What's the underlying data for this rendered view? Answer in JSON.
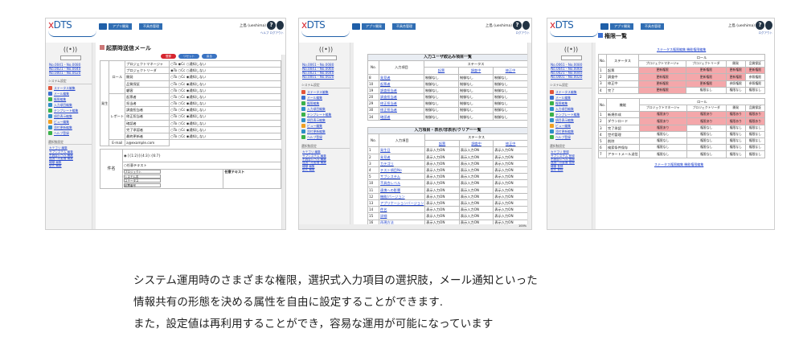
{
  "shot1": {
    "breadcrumb": [
      "アプリ開発",
      "不具合管理"
    ],
    "user": "上島 (ueshima)",
    "help_links": "ヘルプ ログアウト",
    "side": {
      "links": [
        "No.0041 - No.0080",
        "No.0021 - No.0040",
        "No.0001 - No.0020"
      ],
      "section1": "システム設定",
      "menu": [
        {
          "label": "ステータス編集",
          "color": "#e2553a"
        },
        {
          "label": "メール編集",
          "color": "#3b6fd1"
        },
        {
          "label": "権限編集",
          "color": "#3bb24a"
        },
        {
          "label": "入力項目編集",
          "color": "#2e8fc7"
        },
        {
          "label": "テンプレート編集",
          "color": "#3bb24a"
        },
        {
          "label": "項目表示編集",
          "color": "#2e8fc7"
        },
        {
          "label": "ビュー編集",
          "color": "#f0a022"
        },
        {
          "label": "添付更新編集",
          "color": "#2e8fc7"
        },
        {
          "label": "ヘルプ登録",
          "color": "#3bb24a"
        }
      ],
      "section2": "選択肢設定",
      "small": [
        "カテゴリ 編集",
        "サブシステム 編集",
        "不具合レベル 編集",
        "連携への影響 編集",
        "種類 編集",
        "優先 編集"
      ]
    },
    "title": "起票時送信メール",
    "buttons": [
      "登録",
      "リセット",
      "戻る"
    ],
    "group_recv": "発生",
    "group_role": "ロール",
    "group_report": "レポート",
    "email_label": "E-mail",
    "email_value": "a@example.com",
    "rows": [
      [
        "プロジェクトマネージャ",
        "○To ◉Cc ○通知しない"
      ],
      [
        "プロジェクトリーダ",
        "◉To ○Cc ○通知しない"
      ],
      [
        "開発",
        "○To ○Cc ◉通知しない"
      ],
      [
        "品質保証",
        "○To ○Cc ◉通知しない"
      ],
      [
        "顧客",
        "○To ○Cc ◉通知しない"
      ],
      [
        "起票者",
        "○To ○Cc ◉通知しない"
      ],
      [
        "担当者",
        "○To ○Cc ◉通知しない"
      ],
      [
        "調査担当者",
        "○To ○Cc ◉通知しない"
      ],
      [
        "修正担当者",
        "○To ○Cc ◉通知しない"
      ],
      [
        "確認者",
        "○To ○Cc ◉通知しない"
      ],
      [
        "完了承認者",
        "○To ○Cc ◉通知しない"
      ],
      [
        "最終更新者",
        "○To ○Cc ◉通知しない"
      ]
    ],
    "subject_label": "件名",
    "subject_opt1": "◉ [{1:2}]{4:3}:{6:7}",
    "subject_opt2": "○任意テキスト",
    "any_text": "任意テキスト",
    "selects": [
      "プロジェクト",
      "システム名",
      "ステータス",
      "起票番号"
    ]
  },
  "shot2": {
    "breadcrumb": [
      "アプリ開発",
      "不具合管理"
    ],
    "user": "上島 (ueshima)",
    "help_links": "ログアウト",
    "side": {
      "links": [
        "No.0061 - No.0080",
        "No.0041 - No.0060",
        "No.0021 - No.0040",
        "No.0001 - No.0020"
      ],
      "section1": "システム設定",
      "menu": [
        {
          "label": "ステータス編集",
          "color": "#e2553a"
        },
        {
          "label": "メール編集",
          "color": "#3b6fd1"
        },
        {
          "label": "権限編集",
          "color": "#3bb24a"
        },
        {
          "label": "入力項目編集",
          "color": "#2e8fc7"
        },
        {
          "label": "テンプレート編集",
          "color": "#3bb24a"
        },
        {
          "label": "項目表示編集",
          "color": "#2e8fc7"
        },
        {
          "label": "ビュー編集",
          "color": "#f0a022"
        },
        {
          "label": "添付更新編集",
          "color": "#2e8fc7"
        },
        {
          "label": "ヘルプ登録",
          "color": "#3bb24a"
        }
      ],
      "section2": "選択肢設定",
      "small": [
        "カテゴリ 編集",
        "サブシステム 編集",
        "不具合レベル 編集",
        "連携への影響 編集",
        "種類 編集",
        "優先 編集"
      ]
    },
    "t1": {
      "title": "入力ユーザ絞込み項目一覧",
      "h_no": "No.",
      "h_item": "入力項目",
      "h_status": "ステータス",
      "cols": [
        "起票",
        "調査中",
        "修正中"
      ],
      "rows": [
        [
          "8",
          "発見者",
          "制御なし",
          "制御なし",
          "制御なし"
        ],
        [
          "10",
          "起票者",
          "制御なし",
          "制御なし",
          "制御なし"
        ],
        [
          "19",
          "調査担当者",
          "制御なし",
          "制御なし",
          "制御なし"
        ],
        [
          "20",
          "調査担当者",
          "制御なし",
          "制御なし",
          "制御なし"
        ],
        [
          "29",
          "修正担当者",
          "制御なし",
          "制御なし",
          "制御なし"
        ],
        [
          "30",
          "修正担当者",
          "制御なし",
          "制御なし",
          "制御なし"
        ],
        [
          "34",
          "確認者",
          "制御なし",
          "制御なし",
          "制御なし"
        ]
      ]
    },
    "t2": {
      "title": "入力項目・表示/非表示/クリアー一覧",
      "h_no": "No.",
      "h_item": "入力項目",
      "h_status": "ステータス",
      "cols": [
        "起票",
        "調査中",
        "修正中"
      ],
      "rows": [
        [
          "1",
          "発生日",
          "表示入力ON",
          "表示入力ON",
          "表示入力ON"
        ],
        [
          "2",
          "発見者",
          "表示入力ON",
          "表示入力ON",
          "表示入力ON"
        ],
        [
          "3",
          "カテゴリ",
          "表示入力ON",
          "表示入力ON",
          "表示入力ON"
        ],
        [
          "4",
          "テスト項目No",
          "表示入力ON",
          "表示入力ON",
          "表示入力ON"
        ],
        [
          "5",
          "サブシステム",
          "表示入力ON",
          "表示入力ON",
          "表示入力ON"
        ],
        [
          "10",
          "不具合レベル",
          "表示入力ON",
          "表示入力ON",
          "表示入力ON"
        ],
        [
          "11",
          "連携への影響",
          "表示入力ON",
          "表示入力ON",
          "表示入力ON"
        ],
        [
          "12",
          "機能/バージョン",
          "表示入力ON",
          "表示入力ON",
          "表示入力ON"
        ],
        [
          "13",
          "アプリケーションバージョン",
          "表示入力ON",
          "表示入力ON",
          "表示入力ON"
        ],
        [
          "14",
          "件名",
          "表示入力ON",
          "表示入力ON",
          "表示入力ON"
        ],
        [
          "15",
          "詳細",
          "表示入力ON",
          "表示入力ON",
          "表示入力ON"
        ],
        [
          "16",
          "再現方法",
          "表示入力ON",
          "表示入力ON",
          "表示入力ON"
        ]
      ]
    },
    "zoom": "100%"
  },
  "shot3": {
    "breadcrumb": [
      "アプリ開発",
      "不具合管理"
    ],
    "user": "上島 (ueshima)",
    "help_links": "ログアウト",
    "side": {
      "links": [
        "No.0061 - No.0080",
        "No.0041 - No.0060",
        "No.0021 - No.0040",
        "No.0001 - No.0020"
      ],
      "section1": "システム設定",
      "menu": [
        {
          "label": "ステータス編集",
          "color": "#e2553a"
        },
        {
          "label": "メール編集",
          "color": "#3b6fd1"
        },
        {
          "label": "権限編集",
          "color": "#3bb24a"
        },
        {
          "label": "入力項目編集",
          "color": "#2e8fc7"
        },
        {
          "label": "テンプレート編集",
          "color": "#3bb24a"
        },
        {
          "label": "項目表示編集",
          "color": "#2e8fc7"
        },
        {
          "label": "ビュー編集",
          "color": "#f0a022"
        },
        {
          "label": "添付更新編集",
          "color": "#2e8fc7"
        },
        {
          "label": "ヘルプ登録",
          "color": "#3bb24a"
        }
      ],
      "section2": "選択肢設定",
      "small": [
        "カテゴリ 登録",
        "サブシステム 登録",
        "不具合レベル 登録",
        "連携への影響 登録",
        "種類 登録",
        "優先 登録"
      ]
    },
    "title": "権限一覧",
    "link_top": "ステータス権限編集 機能権限編集",
    "link_bottom": "ステータス権限編集 機能権限編集",
    "t1": {
      "h_no": "No.",
      "h_name": "ステータス",
      "h_role": "ロール",
      "cols": [
        "プロジェクトマネージャ",
        "プロジェクトリーダ",
        "開発",
        "品質保証"
      ],
      "rows": [
        [
          "1",
          "起票",
          "更新権限",
          "更新権限",
          "更新権限",
          "更新権限"
        ],
        [
          "2",
          "調査中",
          "更新権限",
          "更新権限",
          "更新権限",
          "参照権限"
        ],
        [
          "3",
          "修正中",
          "更新権限",
          "更新権限",
          "参照権限",
          "参照権限"
        ],
        [
          "4",
          "完了",
          "更新権限",
          "権限なし",
          "権限なし",
          "権限なし"
        ]
      ]
    },
    "t2": {
      "h_no": "No.",
      "h_name": "機能",
      "h_role": "ロール",
      "cols": [
        "プロジェクトマネージャ",
        "プロジェクトリーダ",
        "開発",
        "品質保証"
      ],
      "rows": [
        [
          "1",
          "新規作成",
          "権限あり",
          "権限あり",
          "権限あり",
          "権限あり"
        ],
        [
          "2",
          "ダウンロード",
          "権限あり",
          "権限あり",
          "権限あり",
          "権限あり"
        ],
        [
          "3",
          "完了承認",
          "権限あり",
          "権限なし",
          "権限なし",
          "権限なし"
        ],
        [
          "4",
          "世代管理",
          "権限なし",
          "権限なし",
          "権限なし",
          "権限なし"
        ],
        [
          "5",
          "削除",
          "権限なし",
          "権限なし",
          "権限なし",
          "権限なし"
        ],
        [
          "6",
          "検索条件保存",
          "権限なし",
          "権限なし",
          "権限なし",
          "権限なし"
        ],
        [
          "7",
          "アラートメール送信",
          "権限なし",
          "権限なし",
          "権限なし",
          "権限なし"
        ]
      ]
    }
  },
  "caption": [
    "システム運用時のさまざまな権限，選択式入力項目の選択肢，メール通知といった",
    "情報共有の形態を決める属性を自由に設定することができます.",
    "また，設定値は再利用することができ，容易な運用が可能になっています"
  ]
}
